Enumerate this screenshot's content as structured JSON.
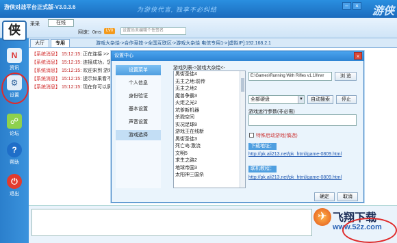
{
  "window": {
    "title": "游侠对战平台正式版-V3.0.3.6",
    "slogan": "为游侠代言, 独享不必纠结",
    "brand": "游侠"
  },
  "user": {
    "name": "采采",
    "status": "在线",
    "delay_label": "网速：0ms",
    "level_badge": "LV0",
    "signature_placeholder": "设置尚未编辑个性签名",
    "logo_char": "侠"
  },
  "tabs": [
    {
      "label": "大厅"
    },
    {
      "label": "专用"
    }
  ],
  "path": "游戏大杂烩->合作竞技->全国互联区->游戏大杂烩 电信专用1->[虚拟IP]:192.168.2.1",
  "sidebar": [
    {
      "label": "资讯",
      "icon": "news-icon"
    },
    {
      "label": "设置",
      "icon": "settings-icon"
    },
    {
      "label": "论坛",
      "icon": "forum-icon"
    },
    {
      "label": "帮助",
      "icon": "help-icon"
    },
    {
      "label": "退出",
      "icon": "exit-icon"
    }
  ],
  "messages": [
    {
      "tag": "【系统消息】",
      "time": "15:12:15:",
      "text": "正在连接 >> 游戏"
    },
    {
      "tag": "【系统消息】",
      "time": "15:12:15:",
      "text": "连接成功，您已经"
    },
    {
      "tag": "【系统消息】",
      "time": "15:12:15:",
      "text": "欢迎来到 游戏大杂"
    },
    {
      "tag": "【系统消息】",
      "time": "15:12:15:",
      "text": "提示如果看不到其"
    },
    {
      "tag": "【系统消息】",
      "time": "15:12:15:",
      "text": "现在你可以屏蔽他"
    }
  ],
  "dialog": {
    "title": "设置中心",
    "close": "×",
    "nav": [
      {
        "label": "设置菜单",
        "kind": "header"
      },
      {
        "label": "个人信息",
        "kind": "normal"
      },
      {
        "label": "身份验证",
        "kind": "normal"
      },
      {
        "label": "基本设置",
        "kind": "normal"
      },
      {
        "label": "声音设置",
        "kind": "normal"
      },
      {
        "label": "游戏选择",
        "kind": "selected"
      }
    ],
    "list_title": "游戏列表->游戏大杂烩<-",
    "games": [
      "黑街圣徒4",
      "无主之地:前传",
      "无主之地2",
      "魔兽争霸3",
      "火炬之光2",
      "坑爹新机器",
      "杀戮空间",
      "实况足球8",
      "游戏王在线新",
      "黑街圣徒3",
      "死亡岛:激流",
      "文明5",
      "求生之路2",
      "地球帝国3",
      "太阳神三国杀"
    ],
    "path_value": "E:\\Games\\Running With Rifles v1.10\\rwr",
    "browse_label": "浏 览",
    "disk_value": "全部硬盘",
    "auto_search_label": "自动搜索",
    "stop_label": "停止",
    "args_label": "游戏运行参数(非必需)",
    "special_label": "特殊启动游戏(慎选)",
    "download_title": "下载地址：",
    "download_url": "http://pk.ali213.net/pk_html/game-0809.html",
    "forum_title": "联机教程：",
    "forum_url": "http://pk.ali213.net/pk_html/game-0809.html",
    "ok_label": "确定",
    "cancel_label": "取消"
  },
  "watermark": {
    "text": "飞翔下载",
    "url": "www.52z.com"
  }
}
